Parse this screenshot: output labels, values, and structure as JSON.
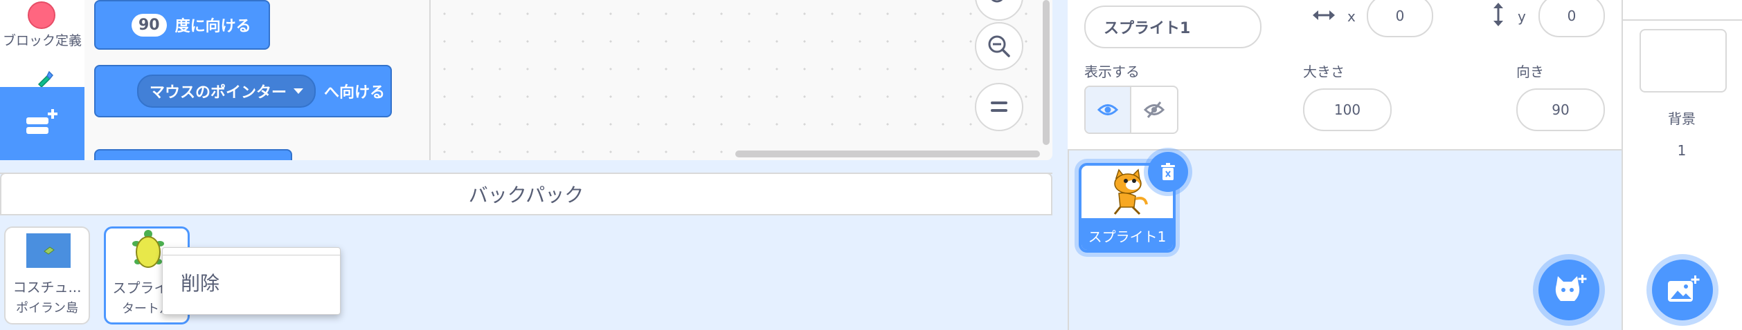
{
  "palette": {
    "category_label": "ブロック定義",
    "category_color": "#ff6680",
    "blocks": {
      "point_direction_value": "90",
      "point_direction_text": "度に向ける",
      "point_towards_menu": "マウスのポインター",
      "point_towards_text": "へ向ける"
    }
  },
  "backpack": {
    "title": "バックパック",
    "items": [
      {
        "name": "コスチュ...",
        "sub": "ポイラン島"
      },
      {
        "name": "スプライ...",
        "sub": "タートル"
      }
    ],
    "context_menu": {
      "delete": "削除"
    }
  },
  "sprite_info": {
    "name": "スプライト1",
    "x_label": "x",
    "x_value": "0",
    "y_label": "y",
    "y_value": "0",
    "show_label": "表示する",
    "size_label": "大きさ",
    "size_value": "100",
    "direction_label": "向き",
    "direction_value": "90"
  },
  "sprite_list": {
    "sprites": [
      {
        "name": "スプライト1"
      }
    ]
  },
  "stage": {
    "label": "背景",
    "count": "1"
  },
  "colors": {
    "accent": "#4c97ff",
    "text": "#575e75"
  }
}
